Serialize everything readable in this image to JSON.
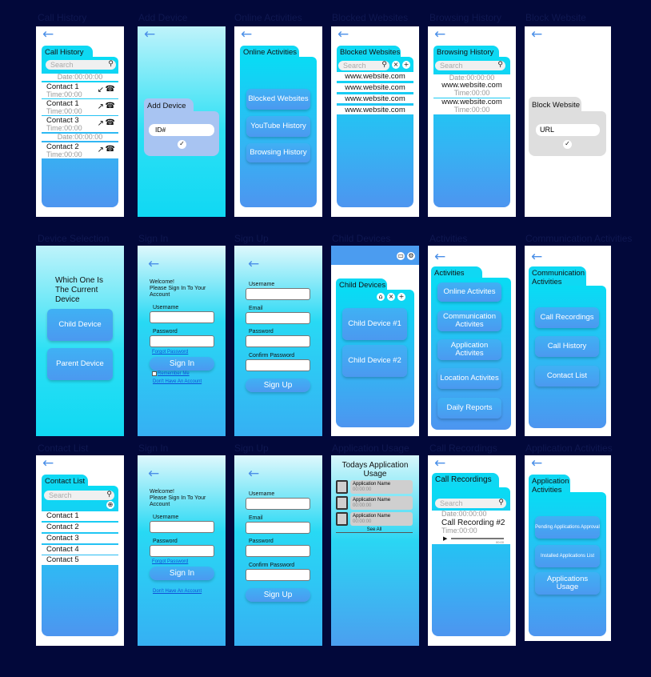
{
  "labels": [
    "Call History",
    "Add Device",
    "Online Activities",
    "Blocked Websites",
    "Browsing History",
    "Block Website",
    "Device Selection",
    "Sign In",
    "Sign Up",
    "Child Devices",
    "Activities",
    "Communication Activities",
    "Contact List",
    "Sign In",
    "Sign Up",
    "Application Usage",
    "Call Recordings",
    "Application Activities"
  ],
  "common": {
    "search": "Search",
    "date": "Date:00:00:00",
    "time": "Time:00:00",
    "url": "www.website.com"
  },
  "callHistory": {
    "title": "Call History",
    "contacts": [
      "Contact 1",
      "Contact 1",
      "Contact 3",
      "Contact 2"
    ]
  },
  "addDevice": {
    "title": "Add Device",
    "placeholder": "ID#"
  },
  "online": {
    "title": "Online Activities",
    "buttons": [
      "Blocked Websites",
      "YouTube History",
      "Browsing History"
    ]
  },
  "blocked": {
    "title": "Blocked Websites"
  },
  "browsing": {
    "title": "Browsing History"
  },
  "blockWebsite": {
    "title": "Block Website",
    "placeholder": "URL"
  },
  "which": {
    "question": "Which One Is The Current Device",
    "child": "Child Device",
    "parent": "Parent Device"
  },
  "signin": {
    "welcome": "Welcome!\nPlease Sign In To Your Account",
    "username": "Username",
    "password": "Password",
    "forgot": "Forgot Password",
    "button": "Sign In",
    "remember": "Remember Me",
    "noaccount": "Don't Have An Account"
  },
  "signup": {
    "username": "Username",
    "email": "Email",
    "password": "Password",
    "confirm": "Confirm Password",
    "button": "Sign Up"
  },
  "childDevices": {
    "title": "Child Devices",
    "devices": [
      "Child Device #1",
      "Child Device #2"
    ]
  },
  "activities": {
    "title": "Activities",
    "buttons": [
      "Online Activites",
      "Communication Activites",
      "Application Activites",
      "Location Activites",
      "Daily Reports"
    ]
  },
  "comm": {
    "title": "Communication Activities",
    "buttons": [
      "Call Recordings",
      "Call History",
      "Contact List"
    ]
  },
  "contactList": {
    "title": "Contact List",
    "contacts": [
      "Contact 1",
      "Contact 2",
      "Contact 3",
      "Contact 4",
      "Contact 5"
    ]
  },
  "appUsage": {
    "title": "Todays Application Usage",
    "apps": [
      "Application Name",
      "Application Name",
      "Application Name"
    ],
    "time": "00:00:00",
    "seeAll": "See All"
  },
  "callRec": {
    "title": "Call Recordings",
    "item": "Call Recording #2",
    "duration": "00:00"
  },
  "appAct": {
    "title": "Application Activities",
    "buttons": [
      "Pending Applications Approval",
      "Installed Applications List",
      "Applications Usage"
    ]
  }
}
